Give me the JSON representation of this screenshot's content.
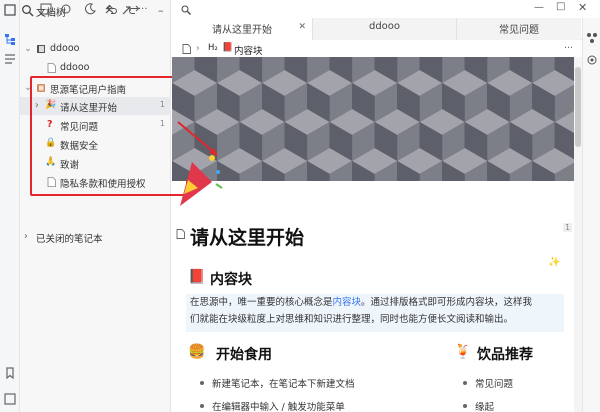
{
  "sidebar": {
    "title": "文档树",
    "notebooks": [
      {
        "label": "ddooo",
        "children": [
          {
            "label": "ddooo"
          }
        ]
      },
      {
        "label": "思源笔记用户指南",
        "children": [
          {
            "label": "请从这里开始",
            "count": "1"
          },
          {
            "label": "常见问题",
            "count": "1"
          },
          {
            "label": "数据安全"
          },
          {
            "label": "致谢"
          },
          {
            "label": "隐私条款和使用授权"
          }
        ]
      }
    ],
    "closed_label": "已关闭的笔记本"
  },
  "tabs": [
    {
      "label": "请从这里开始",
      "active": true
    },
    {
      "label": "ddooo"
    },
    {
      "label": "常见问题"
    }
  ],
  "breadcrumb": {
    "heading_level": "H₂",
    "label": "内容块"
  },
  "doc": {
    "title": "请从这里开始",
    "title_badge": "1",
    "section1": {
      "heading": "内容块"
    },
    "para_pre": "在思源中，唯一重要的核心概念是",
    "para_link": "内容块",
    "para_post": "。通过排版格式即可形成内容块，这样我",
    "para_line2": "们就能在块级粒度上对思维和知识进行整理，同时也能方便长文阅读和输出。",
    "section2": {
      "heading": "开始食用",
      "items": [
        "新建笔记本，在笔记本下新建文档",
        "在编辑器中输入 / 触发功能菜单"
      ]
    },
    "section3": {
      "heading": "饮品推荐",
      "links": [
        "常见问题",
        "缘起"
      ]
    }
  },
  "colors": {
    "accent": "#3575f0",
    "highlight_box": "#e3262c",
    "para_bg": "#eef5fb"
  }
}
